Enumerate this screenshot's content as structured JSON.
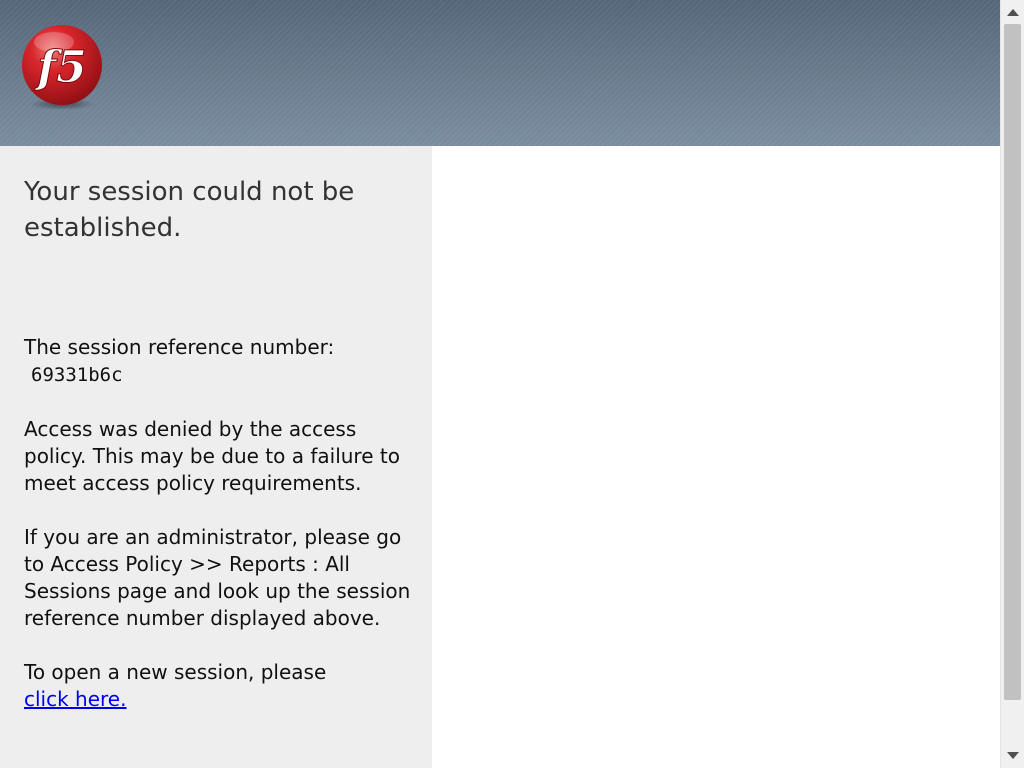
{
  "header": {
    "logo": {
      "icon": "f5-logo-icon",
      "text": "f5",
      "colors": {
        "ball": "#c4161c",
        "highlight": "#f26b6b",
        "text": "#ffffff"
      }
    },
    "background": "#66788a"
  },
  "main": {
    "title": "Your session could not be established.",
    "reference_label": "The session reference number:",
    "reference_number": "69331b6c",
    "denied_text": "Access was denied by the access policy. This may be due to a failure to meet access policy requirements.",
    "admin_text": "If you are an administrator, please go to Access Policy >> Reports : All Sessions page and look up the session reference number displayed above.",
    "new_session_text": "To open a new session, please",
    "new_session_link": "click here."
  },
  "scrollbar": {
    "up_icon": "scroll-up-arrow-icon",
    "down_icon": "scroll-down-arrow-icon"
  }
}
